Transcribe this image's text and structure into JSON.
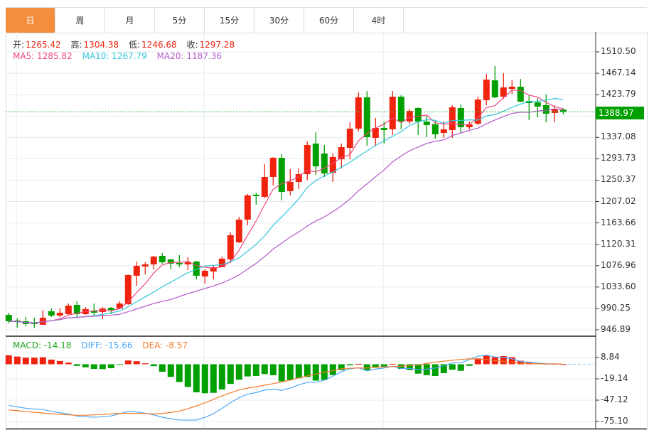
{
  "tabs": [
    {
      "label": "日",
      "active": true
    },
    {
      "label": "周"
    },
    {
      "label": "月"
    },
    {
      "label": "5分"
    },
    {
      "label": "15分"
    },
    {
      "label": "30分"
    },
    {
      "label": "60分"
    },
    {
      "label": "4时"
    }
  ],
  "ohlc_legend": {
    "open_label": "开:",
    "open": "1265.42",
    "high_label": "高:",
    "high": "1304.38",
    "low_label": "低:",
    "low": "1246.68",
    "close_label": "收:",
    "close": "1297.28"
  },
  "ma_legend": {
    "ma5": "MA5: 1285.82",
    "ma10": "MA10: 1267.79",
    "ma20": "MA20: 1187.36"
  },
  "macd_legend": {
    "macd": "MACD: -14.18",
    "diff": "DIFF: -15.66",
    "dea": "DEA: -8.57"
  },
  "last_price": "1388.97",
  "colors": {
    "up": "#f0230f",
    "down": "#00a000",
    "ma5": "#f0477c",
    "ma10": "#36c6dc",
    "ma20": "#b35ac9",
    "diff": "#4da6f5",
    "dea": "#f57a2a",
    "accent": "#f38e3e"
  },
  "chart_data": [
    {
      "type": "candlestick",
      "y_ticks": [
        "1510.50",
        "1467.14",
        "1423.79",
        "1380.43",
        "1337.08",
        "1293.73",
        "1250.37",
        "1207.02",
        "1163.66",
        "1120.31",
        "1076.96",
        "1033.60",
        "990.25",
        "946.89"
      ],
      "ylim": [
        946.89,
        1510.5
      ],
      "grid": true,
      "ohlc": [
        [
          977.2,
          981.5,
          959.9,
          964.2
        ],
        [
          965.6,
          970.0,
          951.2,
          962.8
        ],
        [
          964.2,
          972.8,
          954.1,
          958.5
        ],
        [
          961.3,
          971.4,
          951.2,
          958.5
        ],
        [
          957.0,
          987.2,
          957.0,
          971.4
        ],
        [
          984.4,
          990.1,
          972.8,
          975.7
        ],
        [
          975.7,
          990.1,
          972.8,
          981.5
        ],
        [
          978.6,
          1000.2,
          977.2,
          995.9
        ],
        [
          997.3,
          1004.5,
          972.8,
          978.6
        ],
        [
          978.6,
          993.0,
          977.2,
          988.7
        ],
        [
          985.8,
          1000.2,
          975.7,
          981.5
        ],
        [
          982.9,
          993.0,
          968.5,
          990.1
        ],
        [
          991.6,
          993.0,
          978.6,
          987.2
        ],
        [
          990.1,
          1004.5,
          988.7,
          1000.2
        ],
        [
          998.8,
          1059.3,
          997.3,
          1057.9
        ],
        [
          1056.5,
          1085.3,
          1036.2,
          1076.7
        ],
        [
          1075.2,
          1083.9,
          1059.3,
          1079.5
        ],
        [
          1079.5,
          1096.8,
          1069.5,
          1095.4
        ],
        [
          1096.8,
          1102.6,
          1081.0,
          1083.9
        ],
        [
          1089.6,
          1091.1,
          1069.5,
          1081.0
        ],
        [
          1082.4,
          1098.3,
          1073.8,
          1079.5
        ],
        [
          1079.5,
          1094.0,
          1068.0,
          1085.3
        ],
        [
          1085.3,
          1086.7,
          1049.2,
          1056.5
        ],
        [
          1055.0,
          1069.5,
          1040.6,
          1066.6
        ],
        [
          1065.1,
          1078.1,
          1049.2,
          1073.8
        ],
        [
          1073.8,
          1095.4,
          1073.8,
          1091.1
        ],
        [
          1089.6,
          1144.4,
          1082.4,
          1138.6
        ],
        [
          1124.2,
          1176.1,
          1122.8,
          1170.3
        ],
        [
          1170.3,
          1222.2,
          1158.8,
          1219.4
        ],
        [
          1220.8,
          1225.1,
          1200.6,
          1217.9
        ],
        [
          1216.5,
          1282.8,
          1213.6,
          1256.8
        ],
        [
          1256.8,
          1297.2,
          1239.5,
          1295.7
        ],
        [
          1295.7,
          1302.9,
          1209.3,
          1226.5
        ],
        [
          1228.0,
          1272.7,
          1219.4,
          1246.7
        ],
        [
          1246.7,
          1274.1,
          1232.3,
          1262.6
        ],
        [
          1262.6,
          1328.9,
          1251.0,
          1321.7
        ],
        [
          1324.5,
          1347.6,
          1261.1,
          1278.4
        ],
        [
          1304.3,
          1321.7,
          1256.8,
          1264.0
        ],
        [
          1265.42,
          1304.38,
          1246.68,
          1297.28
        ],
        [
          1292.8,
          1324.5,
          1274.1,
          1317.3
        ],
        [
          1315.9,
          1367.8,
          1292.8,
          1354.8
        ],
        [
          1354.8,
          1428.3,
          1349.1,
          1418.3
        ],
        [
          1418.3,
          1431.2,
          1320.2,
          1337.5
        ],
        [
          1336.1,
          1376.4,
          1318.8,
          1356.3
        ],
        [
          1356.3,
          1369.2,
          1324.5,
          1351.9
        ],
        [
          1353.4,
          1431.2,
          1341.9,
          1419.7
        ],
        [
          1419.7,
          1422.6,
          1353.4,
          1369.2
        ],
        [
          1369.2,
          1395.2,
          1364.9,
          1390.9
        ],
        [
          1396.6,
          1398.1,
          1341.9,
          1369.2
        ],
        [
          1369.2,
          1380.7,
          1337.5,
          1362.0
        ],
        [
          1363.5,
          1370.7,
          1334.6,
          1343.3
        ],
        [
          1346.2,
          1369.2,
          1336.1,
          1353.4
        ],
        [
          1351.9,
          1402.4,
          1336.1,
          1398.1
        ],
        [
          1396.6,
          1403.8,
          1346.2,
          1357.7
        ],
        [
          1357.7,
          1369.2,
          1353.4,
          1363.5
        ],
        [
          1364.9,
          1419.7,
          1362.0,
          1413.9
        ],
        [
          1412.5,
          1465.8,
          1402.4,
          1454.3
        ],
        [
          1452.8,
          1481.7,
          1416.8,
          1418.3
        ],
        [
          1419.7,
          1467.2,
          1415.4,
          1438.4
        ],
        [
          1435.5,
          1452.8,
          1425.5,
          1439.9
        ],
        [
          1439.9,
          1455.7,
          1408.1,
          1409.6
        ],
        [
          1411.0,
          1424.0,
          1372.1,
          1406.7
        ],
        [
          1408.1,
          1416.8,
          1377.9,
          1399.5
        ],
        [
          1402.4,
          1424.0,
          1367.8,
          1385.1
        ],
        [
          1386.5,
          1402.4,
          1367.8,
          1395.2
        ],
        [
          1393.7,
          1396.6,
          1383.6,
          1388.97
        ]
      ],
      "moving_averages": [
        5,
        10,
        20
      ]
    },
    {
      "type": "macd",
      "y_ticks": [
        "8.84",
        "-19.14",
        "-47.12",
        "-75.10"
      ],
      "ylim": [
        -75.1,
        8.84
      ],
      "histogram": [
        11.7,
        10.1,
        8.6,
        8.6,
        9.2,
        6.1,
        4.3,
        2.1,
        -2.1,
        -4.0,
        -6.1,
        -6.4,
        -5.2,
        -0.9,
        4.9,
        4.0,
        1.2,
        -2.5,
        -9.8,
        -16.6,
        -23.3,
        -29.8,
        -36.8,
        -38.1,
        -37.5,
        -33.1,
        -25.8,
        -20.3,
        -16.0,
        -15.4,
        -12.9,
        -14.4,
        -22.4,
        -20.6,
        -18.4,
        -16.9,
        -21.5,
        -20.6,
        -14.18,
        -7.7,
        -1.5,
        0.5,
        -7.7,
        -4.6,
        -3.1,
        0.5,
        -6.1,
        -7.7,
        -12.3,
        -14.4,
        -15.4,
        -11.7,
        -7.1,
        -8.6,
        -2.1,
        7.7,
        11.4,
        9.2,
        10.7,
        9.2,
        4.6,
        3.1,
        1.8,
        0.9,
        0.6,
        0.2
      ],
      "dea": [
        -60.0,
        -60.9,
        -62.1,
        -63.0,
        -64.0,
        -64.9,
        -65.8,
        -66.4,
        -67.0,
        -67.0,
        -66.4,
        -65.8,
        -65.2,
        -64.6,
        -64.3,
        -64.6,
        -64.9,
        -65.2,
        -64.6,
        -63.3,
        -61.5,
        -58.4,
        -54.7,
        -50.7,
        -46.1,
        -41.5,
        -37.5,
        -33.8,
        -31.4,
        -29.5,
        -27.4,
        -25.5,
        -23.1,
        -20.9,
        -17.8,
        -15.4,
        -12.9,
        -10.5,
        -8.57,
        -5.8,
        -5.2,
        -4.9,
        -4.9,
        -4.0,
        -3.4,
        -3.1,
        -2.5,
        -1.8,
        -0.9,
        0.9,
        2.8,
        4.0,
        5.2,
        6.2,
        7.1,
        6.8,
        6.2,
        4.9,
        3.7,
        2.5,
        1.5,
        0.9,
        0.6,
        0.3,
        0.3,
        0.0
      ]
    }
  ]
}
